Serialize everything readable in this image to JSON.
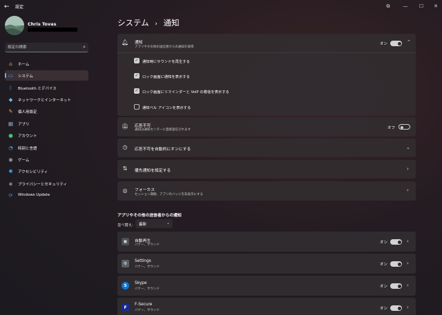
{
  "window": {
    "app_title": "設定",
    "back_glyph": "←",
    "controls": [
      "⧉",
      "—",
      "☐",
      "✕"
    ]
  },
  "profile": {
    "name": "Chris Tovas"
  },
  "search": {
    "placeholder": "設定の検索"
  },
  "sidebar": {
    "items": [
      {
        "label": "ホーム",
        "icon": "home-icon",
        "glyph": "⌂",
        "color": "#e0a05a"
      },
      {
        "label": "システム",
        "icon": "system-icon",
        "glyph": "▭",
        "color": "#4aa3f0",
        "selected": true
      },
      {
        "label": "Bluetooth とデバイス",
        "icon": "bluetooth-icon",
        "glyph": "ᛒ",
        "color": "#3c8de0"
      },
      {
        "label": "ネットワークとインターネット",
        "icon": "network-icon",
        "glyph": "◆",
        "color": "#6fb6f0"
      },
      {
        "label": "個人用設定",
        "icon": "brush-icon",
        "glyph": "✎",
        "color": "#e8a860"
      },
      {
        "label": "アプリ",
        "icon": "apps-icon",
        "glyph": "▦",
        "color": "#8fa4c8"
      },
      {
        "label": "アカウント",
        "icon": "account-icon",
        "glyph": "●",
        "color": "#48c27a"
      },
      {
        "label": "時刻と言語",
        "icon": "clock-language-icon",
        "glyph": "◔",
        "color": "#4aa3f0"
      },
      {
        "label": "ゲーム",
        "icon": "gaming-icon",
        "glyph": "◉",
        "color": "#9aa4b0"
      },
      {
        "label": "アクセシビリティ",
        "icon": "accessibility-icon",
        "glyph": "✱",
        "color": "#4aa3f0"
      },
      {
        "label": "プライバシーとセキュリティ",
        "icon": "shield-icon",
        "glyph": "◈",
        "color": "#9aa0a8"
      },
      {
        "label": "Windows Update",
        "icon": "windows-update-icon",
        "glyph": "⟳",
        "color": "#3c8de0"
      }
    ]
  },
  "page": {
    "breadcrumb_parent": "システム",
    "breadcrumb_sep": "›",
    "breadcrumb_current": "通知"
  },
  "notifications": {
    "title": "通知",
    "subtitle": "アプリやその他の送信者からの通知を取得",
    "toggle_label": "オン",
    "toggle_on": true,
    "options": [
      {
        "label": "通知時にサウンドを再生する",
        "checked": true
      },
      {
        "label": "ロック画面に通知を表示する",
        "checked": true
      },
      {
        "label": "ロック画面にリマインダーと VoIP の着信を表示する",
        "checked": true
      },
      {
        "label": "通知ベル アイコンを表示する",
        "checked": false
      }
    ]
  },
  "dnd": {
    "title": "応答不可",
    "subtitle": "通知は通知センターに直接送信されます",
    "toggle_label": "オフ",
    "toggle_on": false
  },
  "auto_dnd": {
    "title": "応答不可を自動的にオンにする"
  },
  "priority": {
    "title": "優先通知を設定する"
  },
  "focus": {
    "title": "フォーカス",
    "subtitle": "セッション期間、アプリのバッジを非表示にする"
  },
  "apps_section": {
    "title": "アプリやその他の送信者からの通知",
    "sort_label": "並べ替え:",
    "sort_value": "最新",
    "apps": [
      {
        "name": "自動再生",
        "sub": "バナー、サウンド",
        "toggle_label": "オン",
        "icon": "autoplay-icon",
        "glyph": "▣",
        "bg": "#4a4f58"
      },
      {
        "name": "Settings",
        "sub": "バナー、サウンド",
        "toggle_label": "オン",
        "icon": "settings-gear-icon",
        "glyph": "⚙",
        "bg": "#5a6068"
      },
      {
        "name": "Skype",
        "sub": "バナー、サウンド",
        "toggle_label": "オン",
        "icon": "skype-icon",
        "glyph": "S",
        "bg": "#0a78d4"
      },
      {
        "name": "F-Secure",
        "sub": "バナー、サウンド",
        "toggle_label": "オン",
        "icon": "fsecure-icon",
        "glyph": "F",
        "bg": "#1a2b8f"
      }
    ]
  }
}
